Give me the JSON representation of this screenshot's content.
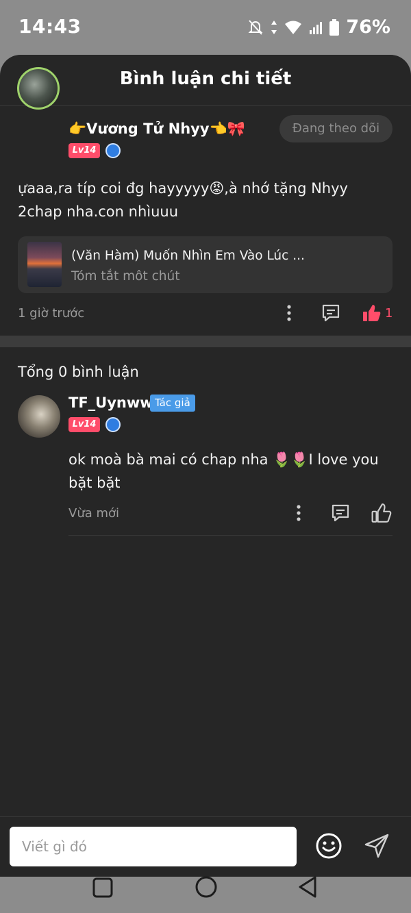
{
  "status": {
    "time": "14:43",
    "battery": "76%"
  },
  "header": {
    "title": "Bình luận chi tiết"
  },
  "post": {
    "username": "👉Vương Tử Nhyy👈🎀",
    "level": "Lv14",
    "follow_label": "Đang theo dõi",
    "text": "ựaaa,ra típ coi đg hayyyyy😡,à nhớ tặng Nhyy 2chap nha.con nhìuuu",
    "story_title": "(Văn Hàm) Muốn Nhìn Em Vào Lúc ...",
    "story_sub": "Tóm tắt môt chút",
    "time": "1 giờ trước",
    "like_count": "1"
  },
  "comments": {
    "total": "Tổng 0 bình luận",
    "items": [
      {
        "username": "TF_Uynww",
        "author_tag": "Tác giả",
        "level": "Lv14",
        "text": "ok moà bà mai có chap nha 🌷🌷I love you bặt bặt",
        "time": "Vừa mới"
      }
    ]
  },
  "composer": {
    "placeholder": "Viết gì đó"
  },
  "colors": {
    "accent": "#ff4d6a",
    "background": "#262626",
    "author_tag": "#4a9be8"
  }
}
